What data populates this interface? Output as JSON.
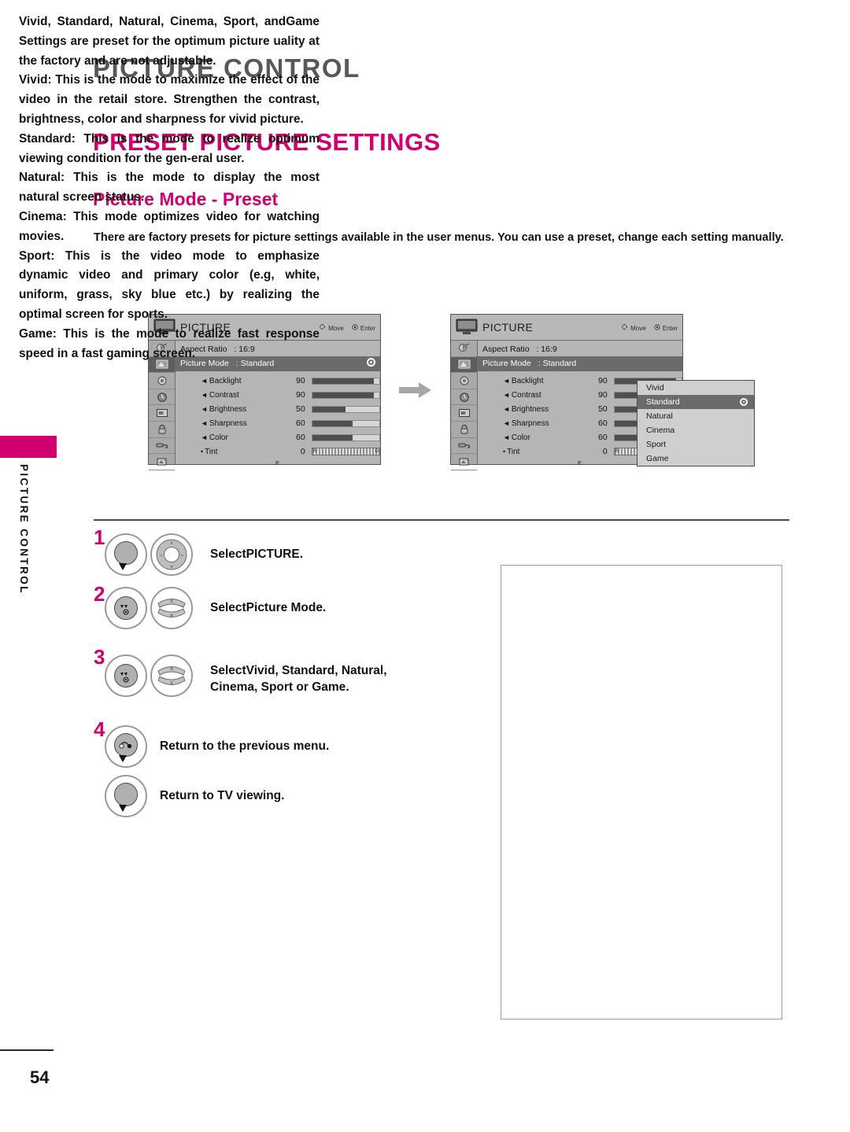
{
  "page": {
    "chapter_title": "PICTURE CONTROL",
    "section_title": "PRESET PICTURE SETTINGS",
    "sub_title": "Picture Mode - Preset",
    "intro": "There are factory presets for picture settings available in the user menus. You can use a preset, change each setting manually.",
    "side_tab_label": "PICTURE CONTROL",
    "page_number": "54",
    "accent_color": "#D1006F"
  },
  "osd": {
    "title": "PICTURE",
    "hint_move": "Move",
    "hint_enter": "Enter",
    "aspect_label": "Aspect Ratio",
    "aspect_value": ": 16:9",
    "mode_label": "Picture Mode",
    "mode_value": ": Standard",
    "e_mark": "E",
    "rail_icons": [
      "satellite-icon",
      "picture-icon",
      "audio-icon",
      "clock-icon",
      "setup-icon",
      "lock-icon",
      "input-icon",
      "usb-icon"
    ],
    "sliders": [
      {
        "label": "Backlight",
        "value": "90",
        "percent": 90
      },
      {
        "label": "Contrast",
        "value": "90",
        "percent": 90
      },
      {
        "label": "Brightness",
        "value": "50",
        "percent": 50
      },
      {
        "label": "Sharpness",
        "value": "60",
        "percent": 60
      },
      {
        "label": "Color",
        "value": "60",
        "percent": 60
      }
    ],
    "tint": {
      "label": "Tint",
      "value": "0",
      "left_mark": "R",
      "right_mark": "G"
    },
    "dropdown": {
      "items": [
        "Vivid",
        "Standard",
        "Natural",
        "Cinema",
        "Sport",
        "Game"
      ],
      "selected": "Standard"
    }
  },
  "steps": [
    {
      "number": "1",
      "text_prefix": "Select",
      "text_bold": "PICTURE",
      "text_suffix": ".",
      "button_left": "menu-button",
      "button_right": "navigation-wheel"
    },
    {
      "number": "2",
      "text_prefix": "Select",
      "text_bold": "Picture Mode",
      "text_suffix": ".",
      "button_left": "enter-button",
      "button_right": "up-down-button"
    },
    {
      "number": "3",
      "text_prefix": "Select",
      "text_bold": "Vivid, Standard, Natural, Cinema, Sport",
      "text_suffix": " or Game.",
      "line1_prefix": "Select",
      "line1_bold": "Vivid, Standard, Natural,",
      "line2_bold_a": "Cinema",
      "line2_sep_a": ", ",
      "line2_bold_b": "Sport",
      "line2_mid": " or ",
      "line2_bold_c": "Game",
      "line2_end": ".",
      "button_left": "enter-button",
      "button_right": "up-down-button"
    },
    {
      "number": "4",
      "text": "Return to the previous menu.",
      "button_left": "back-button"
    },
    {
      "number": "",
      "text": "Return to TV viewing.",
      "button_left": "exit-button"
    }
  ],
  "description": {
    "paragraphs": [
      {
        "bold_lead": "Vivid, Standard, Natural, Cinema, Sport,",
        "mid_plain": " and",
        "bold_two": "Game",
        "rest": " Settings are preset for the optimum picture uality at the factory and are not adjustable."
      },
      {
        "bold_lead": "Vivid",
        "rest": ": This is the mode to maximize the effect of the video in the retail store. Strengthen the contrast, brightness, color and sharpness for vivid picture."
      },
      {
        "bold_lead": "Standard",
        "rest": ": This is the mode to realize optimum viewing condition for the gen-eral user."
      },
      {
        "bold_lead": "Natural",
        "rest": ": This is the mode to display the most natural screen status."
      },
      {
        "bold_lead": "Cinema",
        "rest": ": This mode optimizes video for watching movies."
      },
      {
        "bold_lead": "Sport",
        "rest": ": This is the video mode to emphasize dynamic video and primary color (e.g, white, uniform, grass, sky blue etc.) by realizing the optimal screen for sports."
      },
      {
        "bold_lead": "Game",
        "rest": ": This is the mode to realize fast response speed in a fast gaming screen."
      }
    ]
  }
}
